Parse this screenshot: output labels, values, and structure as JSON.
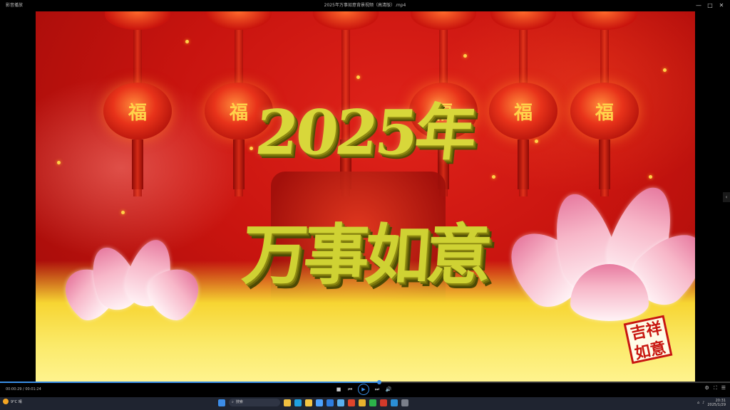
{
  "window": {
    "app_name": "影音播放",
    "title": "2025年万事如意背景视频（高清版）.mp4",
    "controls": {
      "minimize": "—",
      "maximize": "□",
      "close": "✕"
    }
  },
  "video": {
    "year_text": "2025年",
    "wish_text": "万事如意",
    "lantern_char": "福",
    "seal_text": "吉祥\n如意"
  },
  "player": {
    "time": "00:00:29 / 00:01:24",
    "progress_fraction": 0.52,
    "accent_color": "#3a8ee6",
    "controls": {
      "stop": "■",
      "prev": "⏮",
      "play": "▶",
      "next": "⏭",
      "volume": "🔊"
    },
    "right": {
      "settings": "⚙",
      "fullscreen": "⛶",
      "list": "☰"
    }
  },
  "side_panel": {
    "toggle": "‹"
  },
  "taskbar": {
    "weather": "9°C 晴",
    "search_placeholder": "搜索",
    "clock_time": "20:31",
    "clock_date": "2025/1/29",
    "icons": [
      "windows-start",
      "search",
      "widgets",
      "edge",
      "explorer",
      "store",
      "mail",
      "photos",
      "media",
      "chrome",
      "wechat",
      "music",
      "qq",
      "settings"
    ]
  }
}
